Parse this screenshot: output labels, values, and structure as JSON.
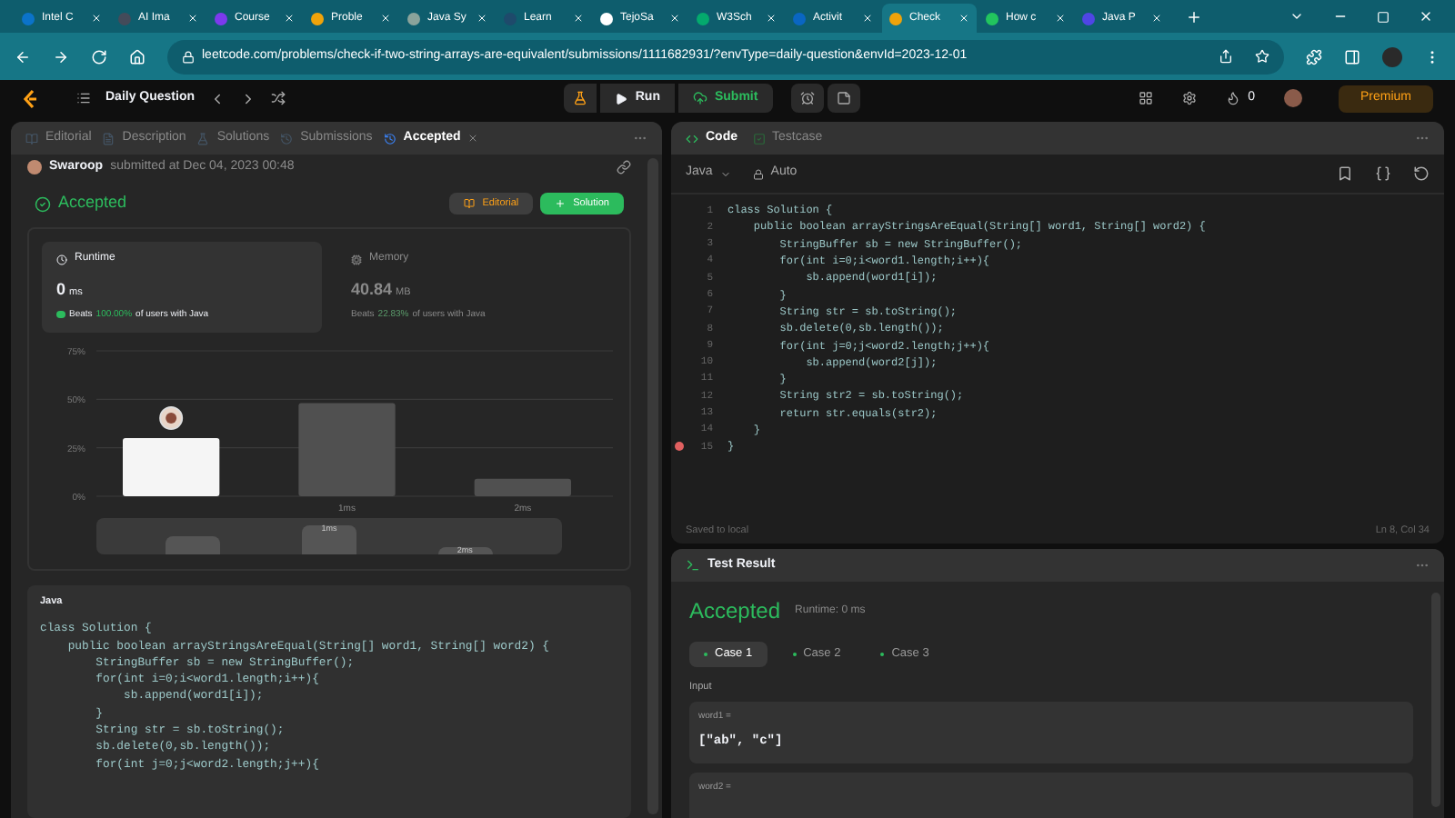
{
  "browser": {
    "tabs": [
      {
        "label": "Intel C",
        "selected": false,
        "color": "#0b73c9"
      },
      {
        "label": "AI Ima",
        "selected": false,
        "color": "#444b5a"
      },
      {
        "label": "Course",
        "selected": false,
        "color": "#7c3aed"
      },
      {
        "label": "Proble",
        "selected": false,
        "color": "#f0a30a"
      },
      {
        "label": "Java Sy",
        "selected": false,
        "color": "#8aa39b"
      },
      {
        "label": "Learn",
        "selected": false,
        "color": "#1e4a6b"
      },
      {
        "label": "TejoSa",
        "selected": false,
        "color": "#ffffff"
      },
      {
        "label": "W3Sch",
        "selected": false,
        "color": "#04aa6d"
      },
      {
        "label": "Activit",
        "selected": false,
        "color": "#0a66c2"
      },
      {
        "label": "Check",
        "selected": true,
        "color": "#f0a30a"
      },
      {
        "label": "How c",
        "selected": false,
        "color": "#22c55e"
      },
      {
        "label": "Java P",
        "selected": false,
        "color": "#4f46e5"
      }
    ],
    "url": "leetcode.com/problems/check-if-two-string-arrays-are-equivalent/submissions/1111682931/?envType=daily-question&envId=2023-12-01"
  },
  "nav": {
    "title": "Daily Question",
    "run": "Run",
    "submit": "Submit",
    "streak": "0",
    "premium": "Premium"
  },
  "left": {
    "tabs": [
      {
        "label": "Editorial",
        "selected": false,
        "closable": false
      },
      {
        "label": "Description",
        "selected": false,
        "closable": false
      },
      {
        "label": "Solutions",
        "selected": false,
        "closable": false
      },
      {
        "label": "Submissions",
        "selected": false,
        "closable": false
      },
      {
        "label": "Accepted",
        "selected": true,
        "closable": true
      }
    ],
    "user": "Swaroop",
    "submitted": "submitted at Dec 04, 2023 00:48",
    "status": "Accepted",
    "editorial_button": "Editorial",
    "solution_button": "Solution",
    "stats": [
      {
        "kind": "runtime",
        "title": "Runtime",
        "value": "0",
        "unit": "ms",
        "beats_label": "Beats",
        "beats": "100.00%",
        "beats_suffix": "of users with Java",
        "selected": true
      },
      {
        "kind": "memory",
        "title": "Memory",
        "value": "40.84",
        "unit": "MB",
        "beats_label": "Beats",
        "beats": "22.83%",
        "beats_suffix": "of users with Java",
        "selected": false
      }
    ],
    "chart_data": {
      "type": "bar",
      "categories": [
        null,
        "1ms",
        "2ms"
      ],
      "values": [
        30,
        48,
        9
      ],
      "ylim": [
        0,
        75
      ],
      "yticks": [
        {
          "value": 0,
          "label": "0%"
        },
        {
          "value": 25,
          "label": "25%"
        },
        {
          "value": 50,
          "label": "50%"
        },
        {
          "value": 75,
          "label": "75%"
        }
      ]
    },
    "overview": {
      "labels": [
        "1ms",
        "2ms"
      ]
    },
    "code": {
      "language": "Java",
      "lines": [
        "class Solution {",
        "    public boolean arrayStringsAreEqual(String[] word1, String[] word2) {",
        "        StringBuffer sb = new StringBuffer();",
        "        for(int i=0;i<word1.length;i++){",
        "            sb.append(word1[i]);",
        "        }",
        "        String str = sb.toString();",
        "        sb.delete(0,sb.length());",
        "        for(int j=0;j<word2.length;j++){"
      ]
    }
  },
  "editor": {
    "tabs": [
      {
        "label": "Code",
        "selected": true
      },
      {
        "label": "Testcase",
        "selected": false
      }
    ],
    "language": "Java",
    "mode": "Auto",
    "lines": [
      {
        "n": "1",
        "text": "class Solution {",
        "breakpoint": false
      },
      {
        "n": "2",
        "text": "    public boolean arrayStringsAreEqual(String[] word1, String[] word2) {",
        "breakpoint": false
      },
      {
        "n": "3",
        "text": "        StringBuffer sb = new StringBuffer();",
        "breakpoint": false
      },
      {
        "n": "4",
        "text": "        for(int i=0;i<word1.length;i++){",
        "breakpoint": false
      },
      {
        "n": "5",
        "text": "            sb.append(word1[i]);",
        "breakpoint": false
      },
      {
        "n": "6",
        "text": "        }",
        "breakpoint": false
      },
      {
        "n": "7",
        "text": "        String str = sb.toString();",
        "breakpoint": false
      },
      {
        "n": "8",
        "text": "        sb.delete(0,sb.length());",
        "breakpoint": false
      },
      {
        "n": "9",
        "text": "        for(int j=0;j<word2.length;j++){",
        "breakpoint": false
      },
      {
        "n": "10",
        "text": "            sb.append(word2[j]);",
        "breakpoint": false
      },
      {
        "n": "11",
        "text": "        }",
        "breakpoint": false
      },
      {
        "n": "12",
        "text": "        String str2 = sb.toString();",
        "breakpoint": false
      },
      {
        "n": "13",
        "text": "        return str.equals(str2);",
        "breakpoint": false
      },
      {
        "n": "14",
        "text": "    }",
        "breakpoint": false
      },
      {
        "n": "15",
        "text": "}",
        "breakpoint": true
      }
    ],
    "saved": "Saved to local",
    "cursor": "Ln 8, Col 34"
  },
  "result": {
    "title": "Test Result",
    "status": "Accepted",
    "runtime": "Runtime: 0 ms",
    "cases": [
      {
        "label": "Case 1",
        "selected": true
      },
      {
        "label": "Case 2",
        "selected": false
      },
      {
        "label": "Case 3",
        "selected": false
      }
    ],
    "input_label": "Input",
    "inputs": [
      {
        "name": "word1 =",
        "value": "[\"ab\", \"c\"]"
      },
      {
        "name": "word2 ="
      }
    ]
  }
}
